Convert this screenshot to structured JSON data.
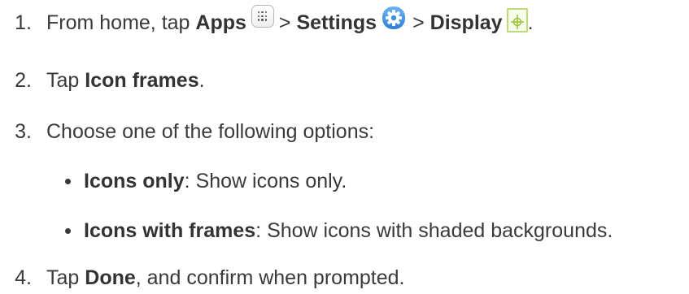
{
  "steps": {
    "step1": {
      "number": "1.",
      "prefix": "From home, tap",
      "apps": "Apps",
      "sep1": ">",
      "settings": "Settings",
      "sep2": ">",
      "display": "Display",
      "end": "."
    },
    "step2": {
      "number": "2.",
      "prefix": "Tap",
      "target": "Icon frames",
      "end": "."
    },
    "step3": {
      "number": "3.",
      "text": "Choose one of the following options:",
      "options": [
        {
          "name": "Icons only",
          "desc": ": Show icons only."
        },
        {
          "name": "Icons with frames",
          "desc": ": Show icons with shaded backgrounds."
        }
      ]
    },
    "step4": {
      "number": "4.",
      "prefix": "Tap",
      "target": "Done",
      "suffix": ", and confirm when prompted."
    }
  },
  "icons": {
    "apps": "apps-grid-icon",
    "settings": "settings-gear-icon",
    "display": "display-settings-icon"
  },
  "colors": {
    "text": "#3a3a3a",
    "settings_blue": "#3f8ee0",
    "display_green": "#9bc53d"
  }
}
